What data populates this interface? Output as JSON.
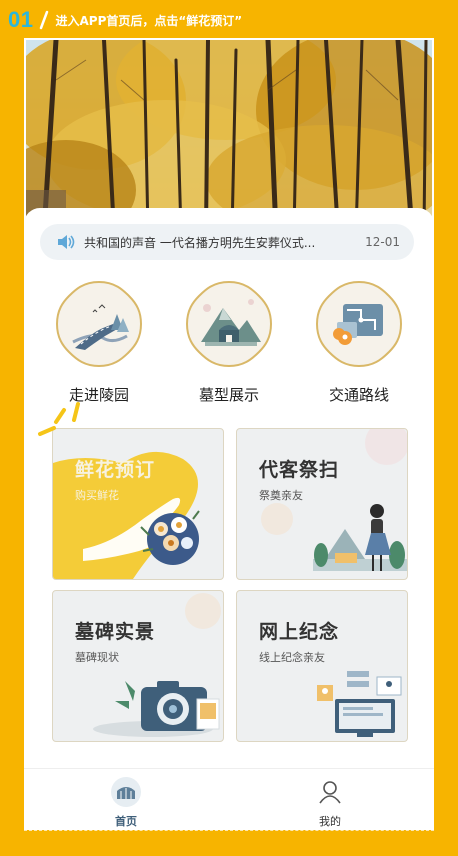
{
  "step": {
    "number": "01",
    "instruction": "进入APP首页后，点击“鲜花预订”"
  },
  "notice": {
    "text": "共和国的声音 一代名播方明先生安葬仪式...",
    "date": "12-01"
  },
  "quick_links": [
    {
      "label": "走进陵园",
      "icon": "road-landscape-icon"
    },
    {
      "label": "墓型展示",
      "icon": "tomb-mountain-icon"
    },
    {
      "label": "交通路线",
      "icon": "route-map-icon"
    }
  ],
  "cards": [
    {
      "title": "鲜花预订",
      "subtitle": "购买鲜花"
    },
    {
      "title": "代客祭扫",
      "subtitle": "祭奠亲友"
    },
    {
      "title": "墓碑实景",
      "subtitle": "墓碑现状"
    },
    {
      "title": "网上纪念",
      "subtitle": "线上纪念亲友"
    }
  ],
  "tabs": [
    {
      "label": "首页",
      "icon": "home-gate-icon",
      "active": true
    },
    {
      "label": "我的",
      "icon": "user-icon",
      "active": false
    }
  ],
  "colors": {
    "frame": "#F7B400",
    "step_number": "#2DB6D8",
    "highlight": "#F5C518",
    "card_bg": "#EEF0F1"
  }
}
